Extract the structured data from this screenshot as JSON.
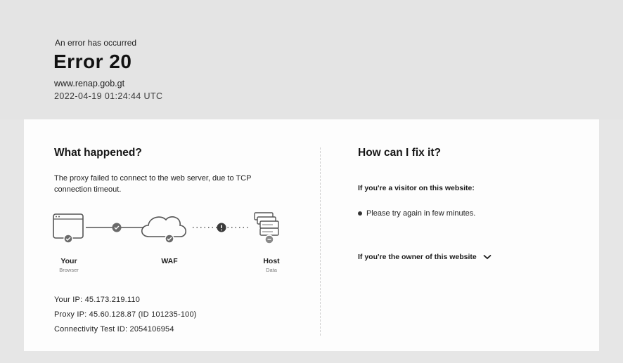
{
  "error": {
    "pretitle": "An error has occurred",
    "title": "Error 20",
    "host": "www.renap.gob.gt",
    "timestamp": "2022-04-19 01:24:44 UTC"
  },
  "what_happened": {
    "heading": "What happened?",
    "description": "The proxy failed to connect to the web server, due to TCP connection timeout."
  },
  "diagram": {
    "nodes": [
      {
        "label": "Your",
        "sublabel": "Browser"
      },
      {
        "label": "WAF",
        "sublabel": ""
      },
      {
        "label": "Host",
        "sublabel": "Data"
      }
    ]
  },
  "details": {
    "your_ip": "Your IP: 45.173.219.110",
    "proxy_ip": "Proxy IP: 45.60.128.87 (ID 101235-100)",
    "connectivity": "Connectivity Test ID: 2054106954"
  },
  "fix": {
    "heading": "How can I fix it?",
    "visitor_heading": "If you're a visitor on this website:",
    "visitor_tip": "Please try again in few minutes.",
    "owner_heading": "If you're the owner of this website"
  },
  "colors": {
    "background": "#e6e6e6",
    "card": "#fdfdfd",
    "text": "#1b1b1b",
    "icon": "#555555"
  }
}
